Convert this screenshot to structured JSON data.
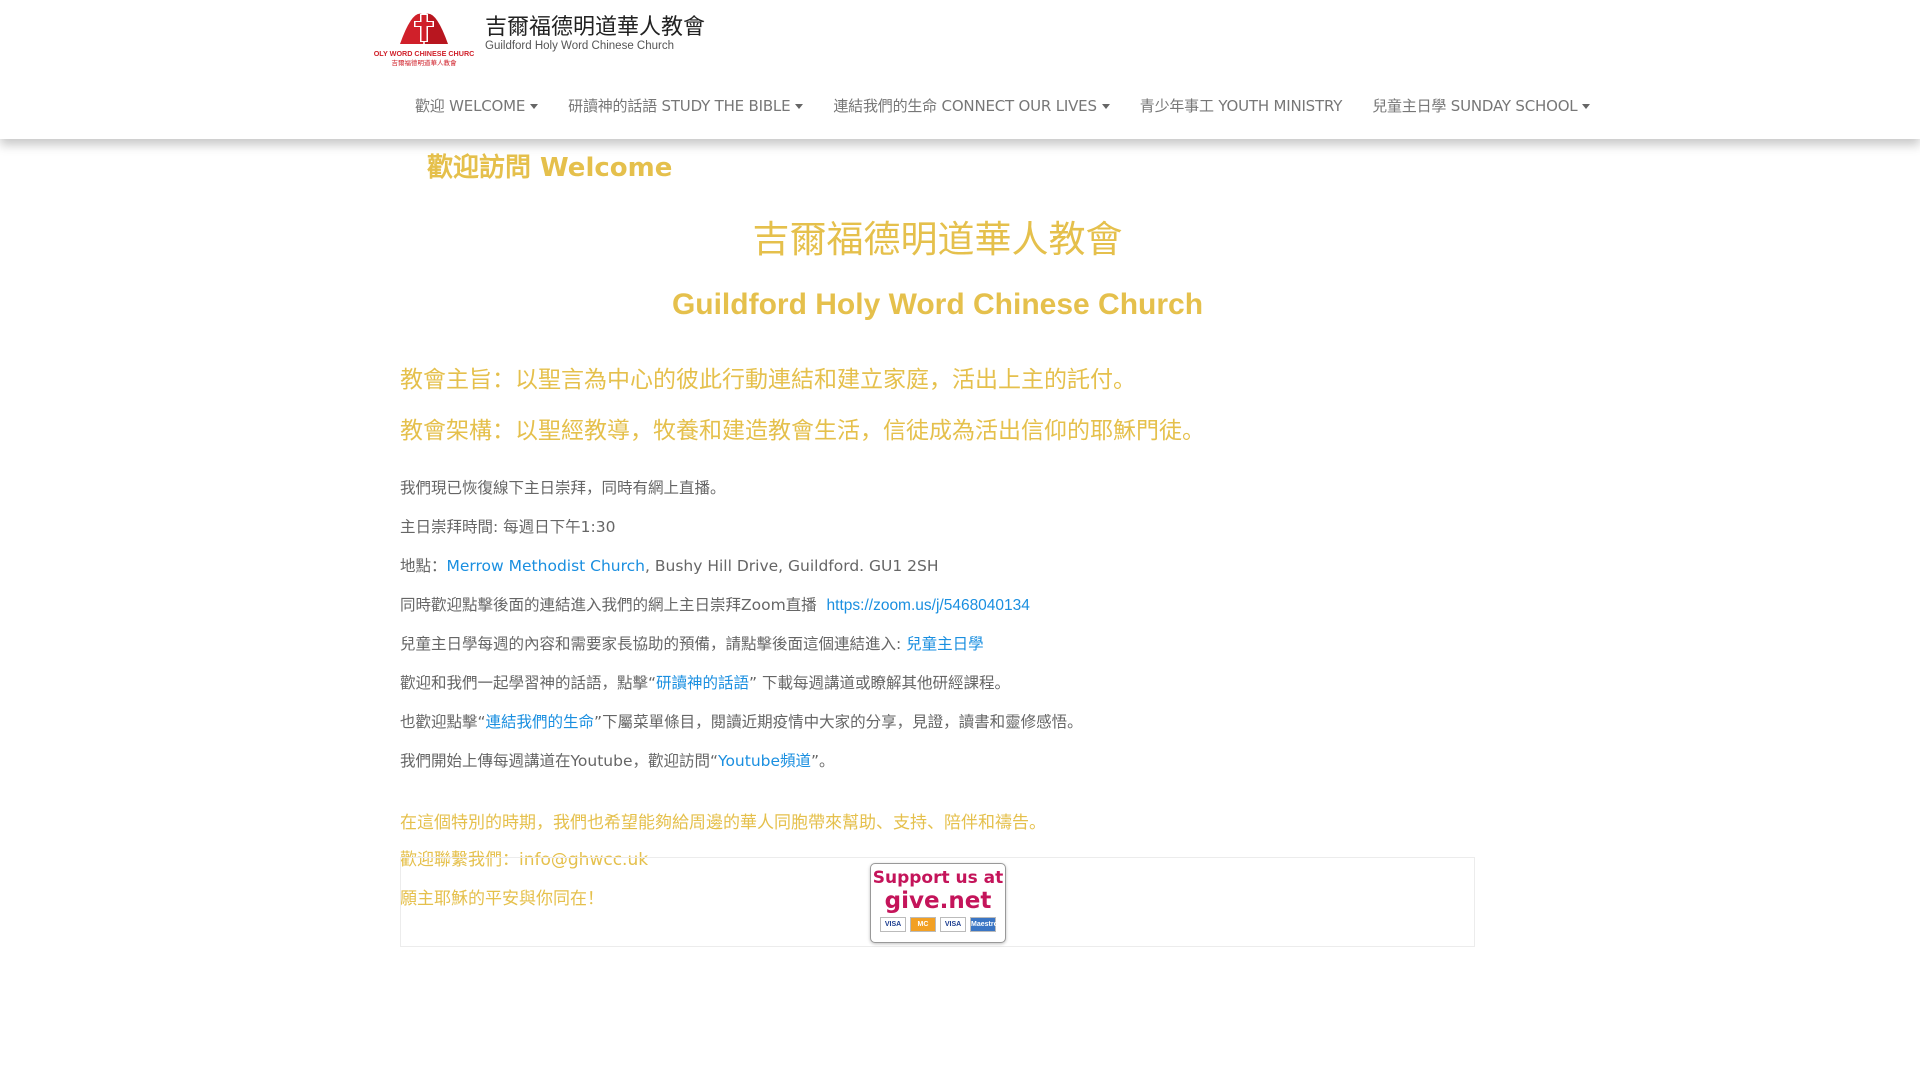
{
  "header": {
    "logo_text": "HOLY WORD CHINESE CHURCH",
    "logo_subtext": "吉爾福德明道華人教會",
    "site_title": "吉爾福德明道華人教會",
    "site_tagline": "Guildford Holy Word Chinese Church",
    "nav": [
      {
        "label": "歡迎 WELCOME",
        "dropdown": true
      },
      {
        "label": "研讀神的話語 STUDY THE BIBLE",
        "dropdown": true
      },
      {
        "label": "連結我們的生命 CONNECT OUR LIVES",
        "dropdown": true
      },
      {
        "label": "青少年事工 YOUTH MINISTRY",
        "dropdown": false
      },
      {
        "label": "兒童主日學 SUNDAY SCHOOL",
        "dropdown": true
      }
    ]
  },
  "main": {
    "page_title": "歡迎訪問 Welcome",
    "heading_cn": "吉爾福德明道華人教會",
    "heading_en": "Guildford Holy Word Chinese Church",
    "mission": "教會主旨：以聖言為中心的彼此行動連結和建立家庭，活出上主的託付。",
    "structure": "教會架構：以聖經教導，牧養和建造教會生活，信徒成為活出信仰的耶穌門徒。",
    "p1": "我們現已恢復線下主日崇拜，同時有網上直播。",
    "p2": "主日崇拜時間: 每週日下午1:30",
    "p3_prefix": "地點：",
    "p3_link": "Merrow Methodist Church",
    "p3_suffix": ", Bushy Hill Drive, Guildford. GU1 2SH",
    "p4_prefix": "同時歡迎點擊後面的連結進入我們的網上主日崇拜Zoom直播  ",
    "p4_link": "https://zoom.us/j/5468040134",
    "p5_prefix": "兒童主日學每週的內容和需要家長協助的預備，請點擊後面這個連結進入: ",
    "p5_link": "兒童主日學",
    "p6_prefix": "歡迎和我們一起學習神的話語，點擊“",
    "p6_link": "研讀神的話語",
    "p6_suffix": "” 下載每週講道或瞭解其他研經課程。",
    "p7_prefix": "也歡迎點擊“",
    "p7_link": "連結我們的生命",
    "p7_suffix": "”下屬菜單條目，閱讀近期疫情中大家的分享，見證，讀書和靈修感悟。",
    "p8_prefix": "我們開始上傳每週講道在Youtube，歡迎訪問“",
    "p8_link": "Youtube頻道",
    "p8_suffix": "”。",
    "gold1": "在這個特別的時期，我們也希望能夠給周邊的華人同胞帶來幫助、支持、陪伴和禱告。",
    "gold2": "歡迎聯繫我們：info@ghwcc.uk",
    "gold3": "願主耶穌的平安與你同在！"
  },
  "widget": {
    "give_line1": "Support us at",
    "give_line2": "give.net",
    "cards": [
      "VISA",
      "MC",
      "VISA",
      "Maestro"
    ]
  },
  "colors": {
    "gold": "#e5c04c",
    "link": "#1a8fe0",
    "logo_red": "#d0202a",
    "give_magenta": "#c4145a"
  }
}
